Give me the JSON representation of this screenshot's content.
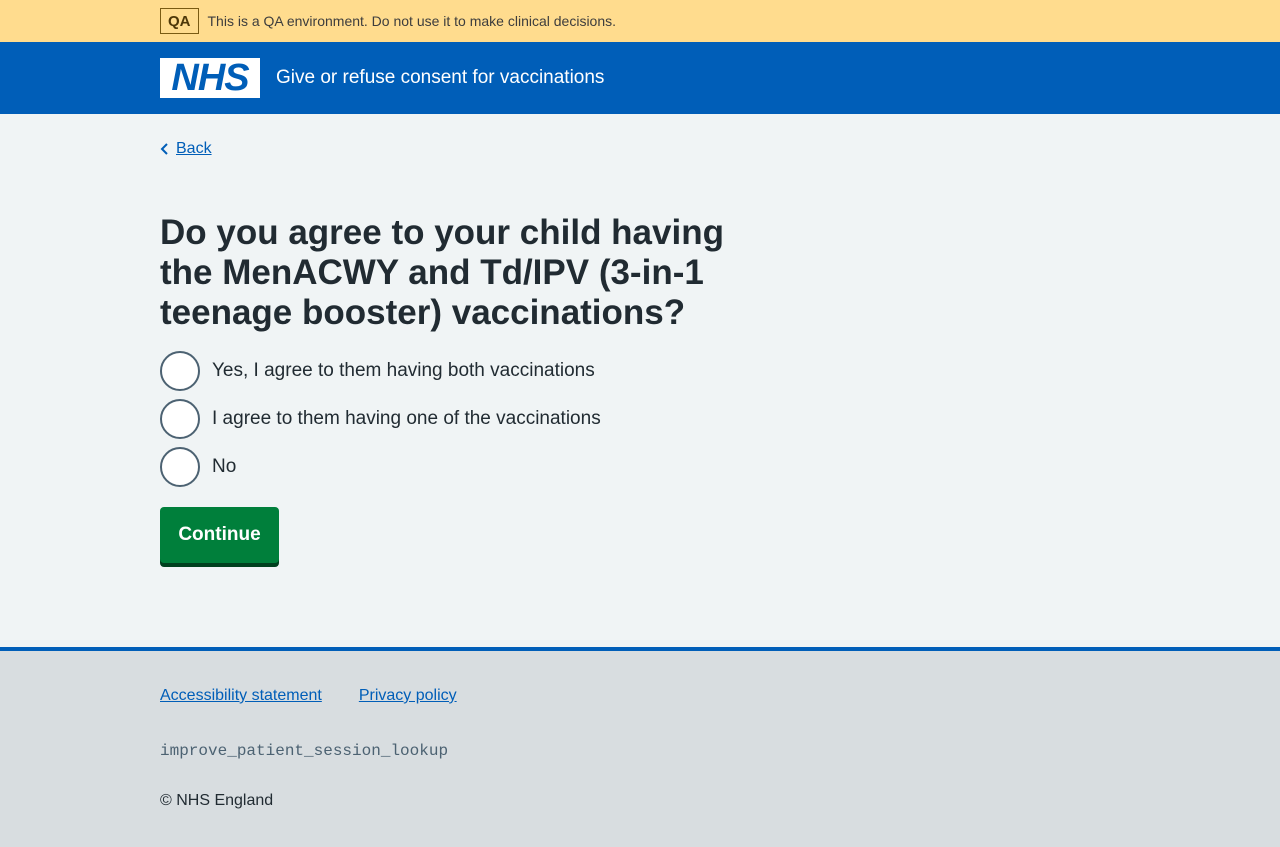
{
  "env_banner": {
    "tag": "QA",
    "message": "This is a QA environment. Do not use it to make clinical decisions."
  },
  "header": {
    "logo_text": "NHS",
    "service_name": "Give or refuse consent for vaccinations"
  },
  "main": {
    "back_label": "Back",
    "question": "Do you agree to your child having the MenACWY and Td/IPV (3-in-1 teenage booster) vaccinations?",
    "options": [
      {
        "label": "Yes, I agree to them having both vaccinations",
        "selected": false
      },
      {
        "label": "I agree to them having one of the vaccinations",
        "selected": false
      },
      {
        "label": "No",
        "selected": false
      }
    ],
    "continue_label": "Continue"
  },
  "footer": {
    "links": [
      "Accessibility statement",
      "Privacy policy"
    ],
    "branch": "improve_patient_session_lookup",
    "copyright": "© NHS England"
  },
  "colors": {
    "nhs_blue": "#005eb8",
    "banner_yellow": "#ffdc8e",
    "button_green": "#007f3b",
    "page_bg": "#f0f4f5",
    "footer_bg": "#d8dde0"
  }
}
